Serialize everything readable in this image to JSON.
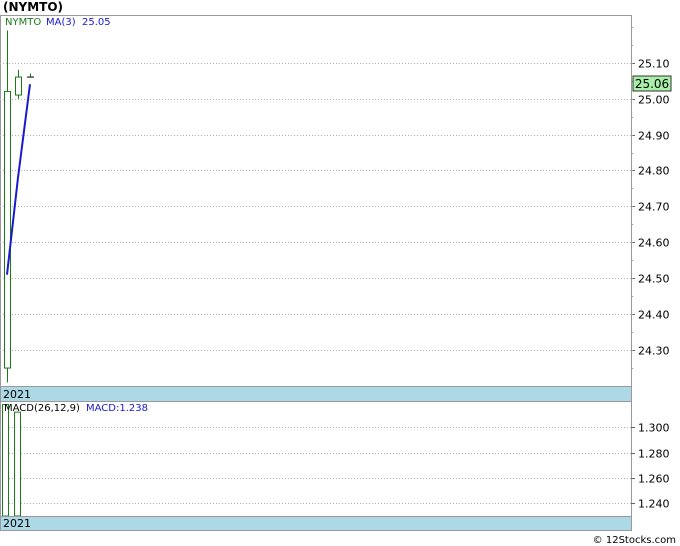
{
  "header": {
    "title": "(NYMTO)"
  },
  "footer": {
    "credit": "© 12Stocks.com"
  },
  "colors": {
    "candle": "#1a7a1a",
    "ma": "#1a1acc",
    "macd": "#1a7a1a",
    "band": "#add8e6",
    "price_tag_bg": "#a8f0a8"
  },
  "chart_data": [
    {
      "type": "candlestick",
      "legend": {
        "symbol": "NYMTO",
        "ma_label": "MA(3)",
        "ma_value": "25.05"
      },
      "x_band_label": "2021",
      "ylim": [
        24.2,
        25.23
      ],
      "yticks": [
        "25.10",
        "25.00",
        "24.90",
        "24.80",
        "24.70",
        "24.60",
        "24.50",
        "24.40",
        "24.30"
      ],
      "last_price": "25.06",
      "candles": [
        {
          "open": 24.25,
          "high": 25.19,
          "low": 24.21,
          "close": 25.02
        },
        {
          "open": 25.01,
          "high": 25.08,
          "low": 25.0,
          "close": 25.06
        },
        {
          "open": 25.06,
          "high": 25.07,
          "low": 25.06,
          "close": 25.06
        }
      ],
      "ma_series": [
        24.51,
        24.78,
        25.04
      ],
      "grid": true
    },
    {
      "type": "bar",
      "legend": {
        "label": "MACD(26,12,9)",
        "value_label": "MACD:1.238"
      },
      "x_band_label": "2021",
      "ylim": [
        1.23,
        1.32
      ],
      "yticks": [
        "1.300",
        "1.280",
        "1.260",
        "1.240"
      ],
      "values": [
        1.318,
        1.312
      ],
      "grid": true
    }
  ]
}
